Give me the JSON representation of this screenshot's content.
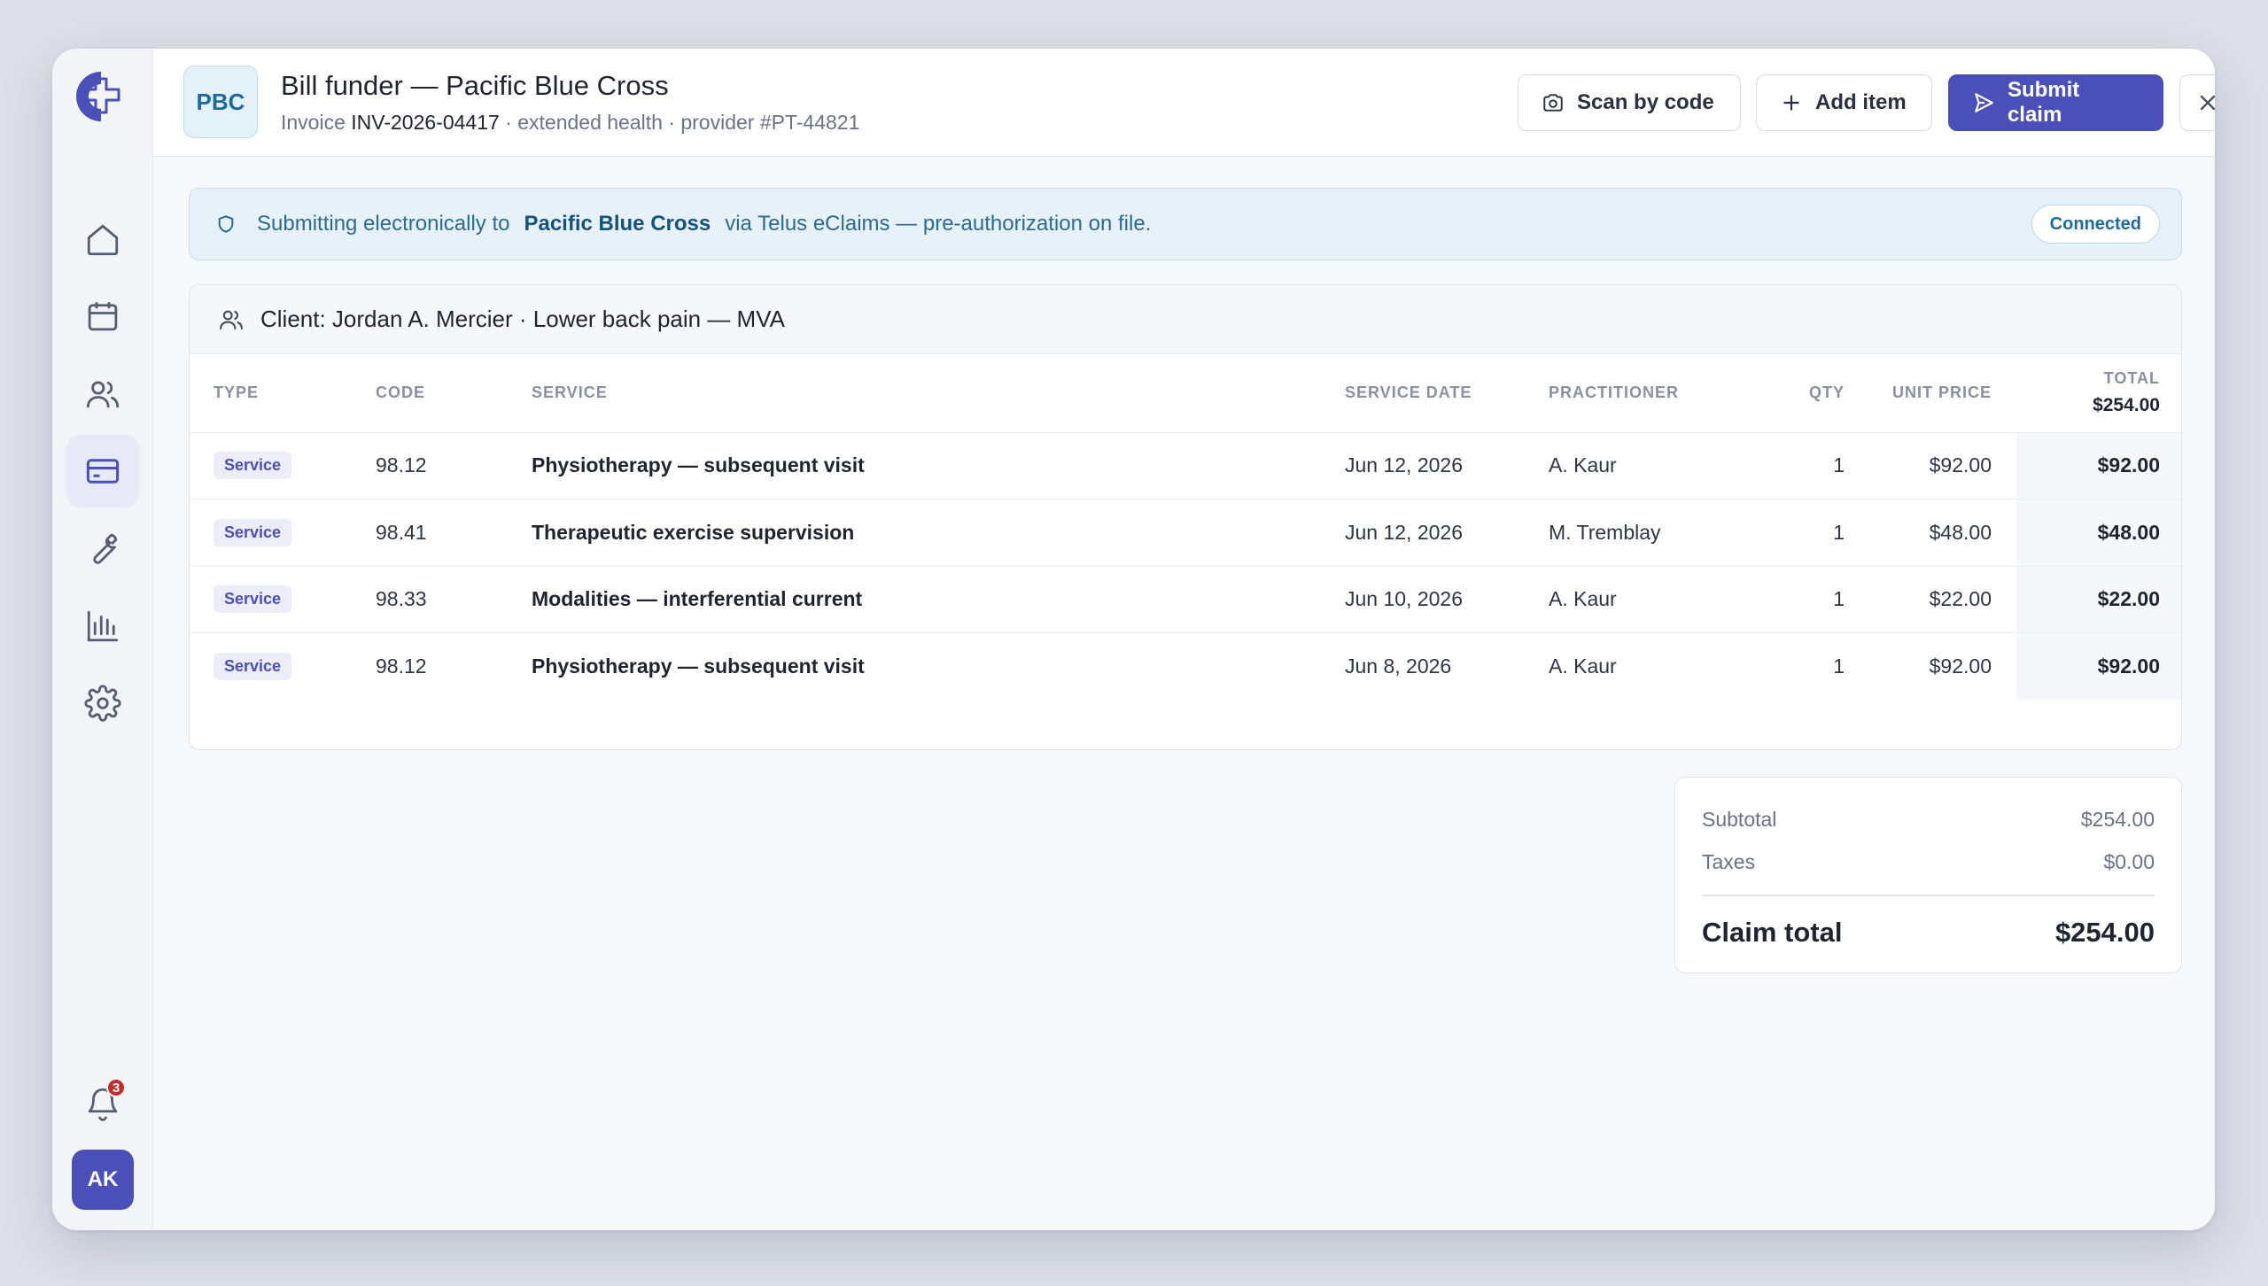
{
  "header": {
    "badge": "PBC",
    "title": "Bill funder — Pacific Blue Cross",
    "invoice_label": "Invoice",
    "invoice_number": "INV-2026-04417",
    "invoice_meta": "· extended health · provider #PT-44821",
    "scan_button": "Scan by code",
    "add_button": "Add item",
    "submit_button": "Submit claim"
  },
  "banner": {
    "prefix": "Submitting electronically to",
    "funder": "Pacific Blue Cross",
    "suffix": "via Telus eClaims — pre-authorization on file.",
    "status": "Connected"
  },
  "client": {
    "label": "Client: Jordan A. Mercier · Lower back pain — MVA"
  },
  "table": {
    "columns": {
      "type": "Type",
      "code": "Code",
      "service": "Service",
      "date": "Service date",
      "practitioner": "Practitioner",
      "qty": "Qty",
      "unit_price": "Unit price",
      "total": "Total",
      "total_value": "$254.00"
    },
    "rows": [
      {
        "type": "Service",
        "code": "98.12",
        "service": "Physiotherapy — subsequent visit",
        "date": "Jun 12, 2026",
        "practitioner": "A. Kaur",
        "qty": "1",
        "unit_price": "$92.00",
        "total": "$92.00"
      },
      {
        "type": "Service",
        "code": "98.41",
        "service": "Therapeutic exercise supervision",
        "date": "Jun 12, 2026",
        "practitioner": "M. Tremblay",
        "qty": "1",
        "unit_price": "$48.00",
        "total": "$48.00"
      },
      {
        "type": "Service",
        "code": "98.33",
        "service": "Modalities — interferential current",
        "date": "Jun 10, 2026",
        "practitioner": "A. Kaur",
        "qty": "1",
        "unit_price": "$22.00",
        "total": "$22.00"
      },
      {
        "type": "Service",
        "code": "98.12",
        "service": "Physiotherapy — subsequent visit",
        "date": "Jun 8, 2026",
        "practitioner": "A. Kaur",
        "qty": "1",
        "unit_price": "$92.00",
        "total": "$92.00"
      }
    ]
  },
  "totals": {
    "subtotal_label": "Subtotal",
    "subtotal": "$254.00",
    "taxes_label": "Taxes",
    "taxes": "$0.00",
    "claim_label": "Claim total",
    "claim": "$254.00"
  },
  "sidebar": {
    "items": [
      {
        "name": "home",
        "icon": "home-icon"
      },
      {
        "name": "calendar",
        "icon": "calendar-icon"
      },
      {
        "name": "clients",
        "icon": "users-icon"
      },
      {
        "name": "billing",
        "icon": "credit-card-icon",
        "active": true
      },
      {
        "name": "tools",
        "icon": "wrench-icon"
      },
      {
        "name": "reports",
        "icon": "bar-chart-icon"
      },
      {
        "name": "settings",
        "icon": "gear-icon"
      }
    ],
    "notifications_count": "3",
    "user_initials": "AK"
  },
  "colors": {
    "accent": "#4b4fb8",
    "banner": "#e6f1f9",
    "badge_alert": "#c42b2b"
  }
}
